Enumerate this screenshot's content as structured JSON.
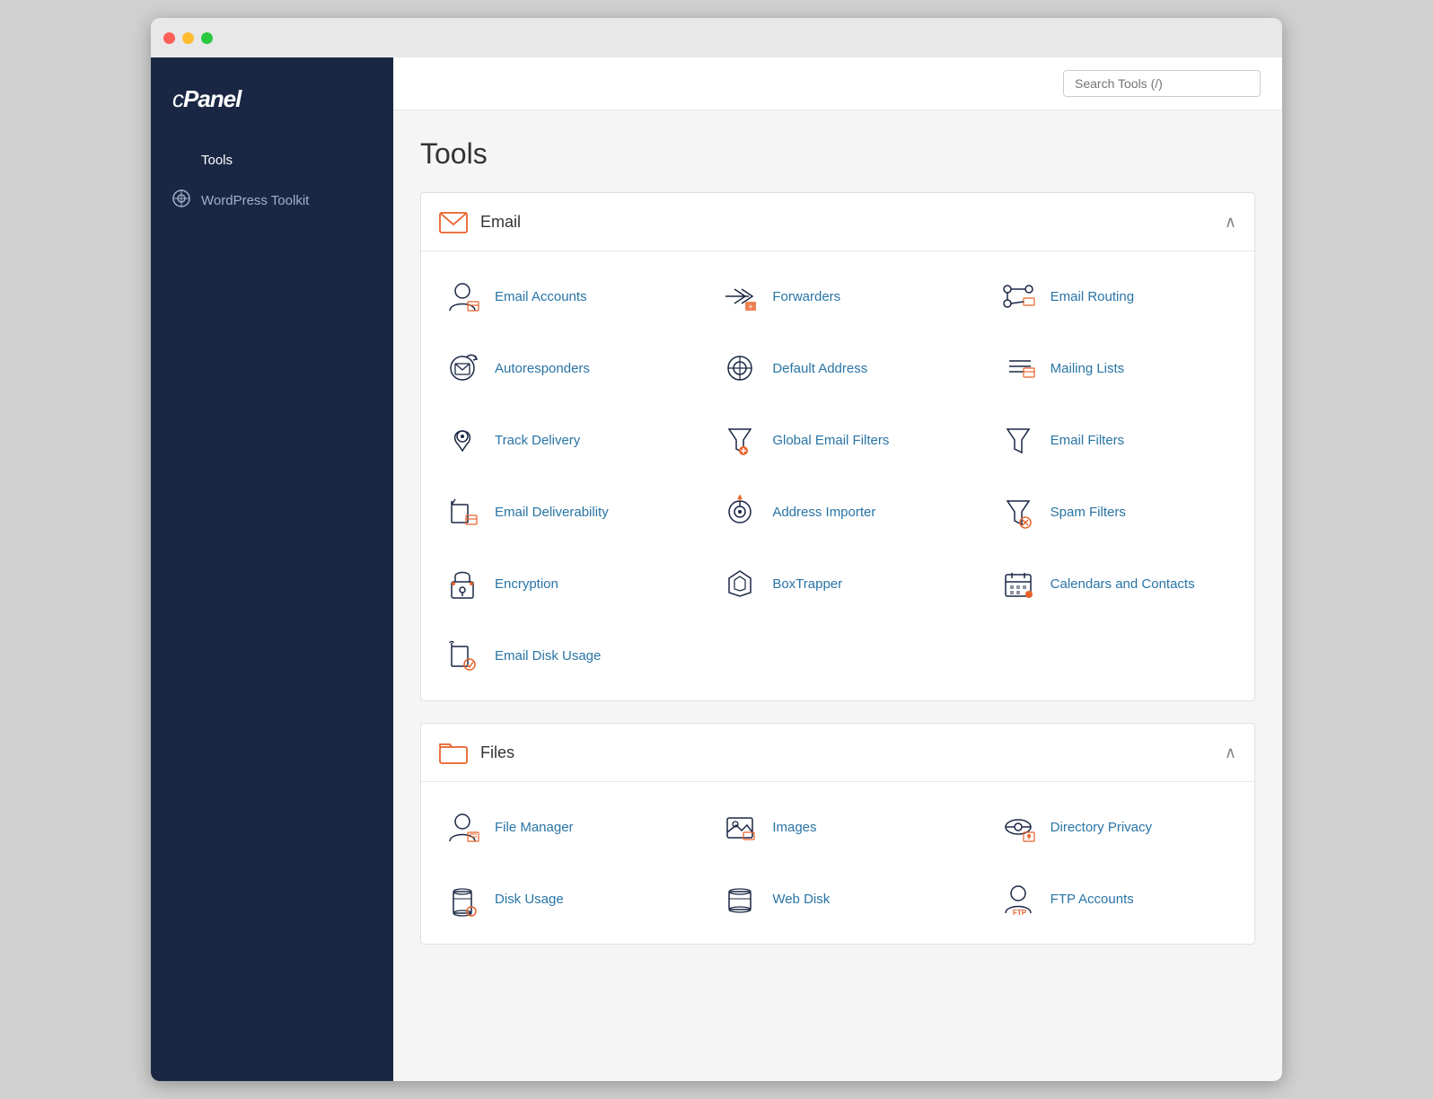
{
  "window": {
    "title": "cPanel Tools"
  },
  "titlebar": {
    "traffic": [
      "red",
      "yellow",
      "green"
    ]
  },
  "sidebar": {
    "logo": "cPanel",
    "items": [
      {
        "id": "tools",
        "label": "Tools",
        "icon": "wrench",
        "active": true
      },
      {
        "id": "wordpress-toolkit",
        "label": "WordPress Toolkit",
        "icon": "wordpress",
        "active": false
      }
    ]
  },
  "topbar": {
    "search_placeholder": "Search Tools (/)"
  },
  "main": {
    "page_title": "Tools",
    "sections": [
      {
        "id": "email",
        "title": "Email",
        "collapsed": false,
        "tools": [
          {
            "id": "email-accounts",
            "name": "Email Accounts"
          },
          {
            "id": "forwarders",
            "name": "Forwarders"
          },
          {
            "id": "email-routing",
            "name": "Email Routing"
          },
          {
            "id": "autoresponders",
            "name": "Autoresponders"
          },
          {
            "id": "default-address",
            "name": "Default Address"
          },
          {
            "id": "mailing-lists",
            "name": "Mailing Lists"
          },
          {
            "id": "track-delivery",
            "name": "Track Delivery"
          },
          {
            "id": "global-email-filters",
            "name": "Global Email Filters"
          },
          {
            "id": "email-filters",
            "name": "Email Filters"
          },
          {
            "id": "email-deliverability",
            "name": "Email Deliverability"
          },
          {
            "id": "address-importer",
            "name": "Address Importer"
          },
          {
            "id": "spam-filters",
            "name": "Spam Filters"
          },
          {
            "id": "encryption",
            "name": "Encryption"
          },
          {
            "id": "boxtrapper",
            "name": "BoxTrapper"
          },
          {
            "id": "calendars-contacts",
            "name": "Calendars and Contacts"
          },
          {
            "id": "email-disk-usage",
            "name": "Email Disk Usage"
          }
        ]
      },
      {
        "id": "files",
        "title": "Files",
        "collapsed": false,
        "tools": [
          {
            "id": "file-manager",
            "name": "File Manager"
          },
          {
            "id": "images",
            "name": "Images"
          },
          {
            "id": "directory-privacy",
            "name": "Directory Privacy"
          },
          {
            "id": "disk-usage",
            "name": "Disk Usage"
          },
          {
            "id": "web-disk",
            "name": "Web Disk"
          },
          {
            "id": "ftp-accounts",
            "name": "FTP Accounts"
          }
        ]
      }
    ]
  }
}
